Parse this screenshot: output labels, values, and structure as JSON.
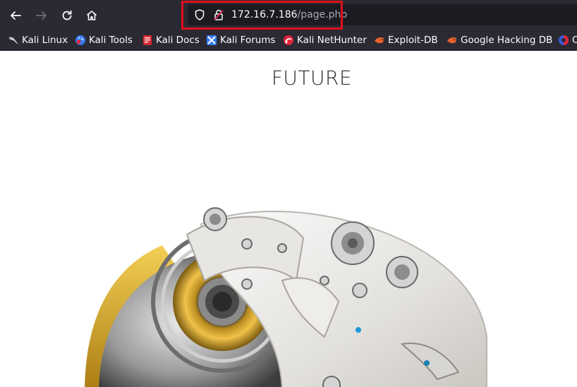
{
  "browser": {
    "url": {
      "host": "172.16.7.186",
      "path": "/page.php"
    },
    "nav": {
      "back_icon": "arrow-left-icon",
      "forward_icon": "arrow-right-icon",
      "reload_icon": "reload-icon",
      "home_icon": "home-icon"
    },
    "bookmarks": [
      {
        "label": "Kali Linux",
        "icon": "kali-dragon-icon"
      },
      {
        "label": "Kali Tools",
        "icon": "kali-tools-icon"
      },
      {
        "label": "Kali Docs",
        "icon": "kali-docs-icon"
      },
      {
        "label": "Kali Forums",
        "icon": "kali-forums-icon"
      },
      {
        "label": "Kali NetHunter",
        "icon": "kali-nethunter-icon"
      },
      {
        "label": "Exploit-DB",
        "icon": "exploit-db-icon"
      },
      {
        "label": "Google Hacking DB",
        "icon": "ghdb-icon"
      },
      {
        "label": "O",
        "icon": "offsec-icon"
      }
    ],
    "colors": {
      "chrome": "#2b2a33",
      "urlbar": "#1c1b22",
      "highlight": "#e0101b"
    }
  },
  "page": {
    "title": "FUTURE",
    "hero_image": "robot-head-illustration"
  }
}
